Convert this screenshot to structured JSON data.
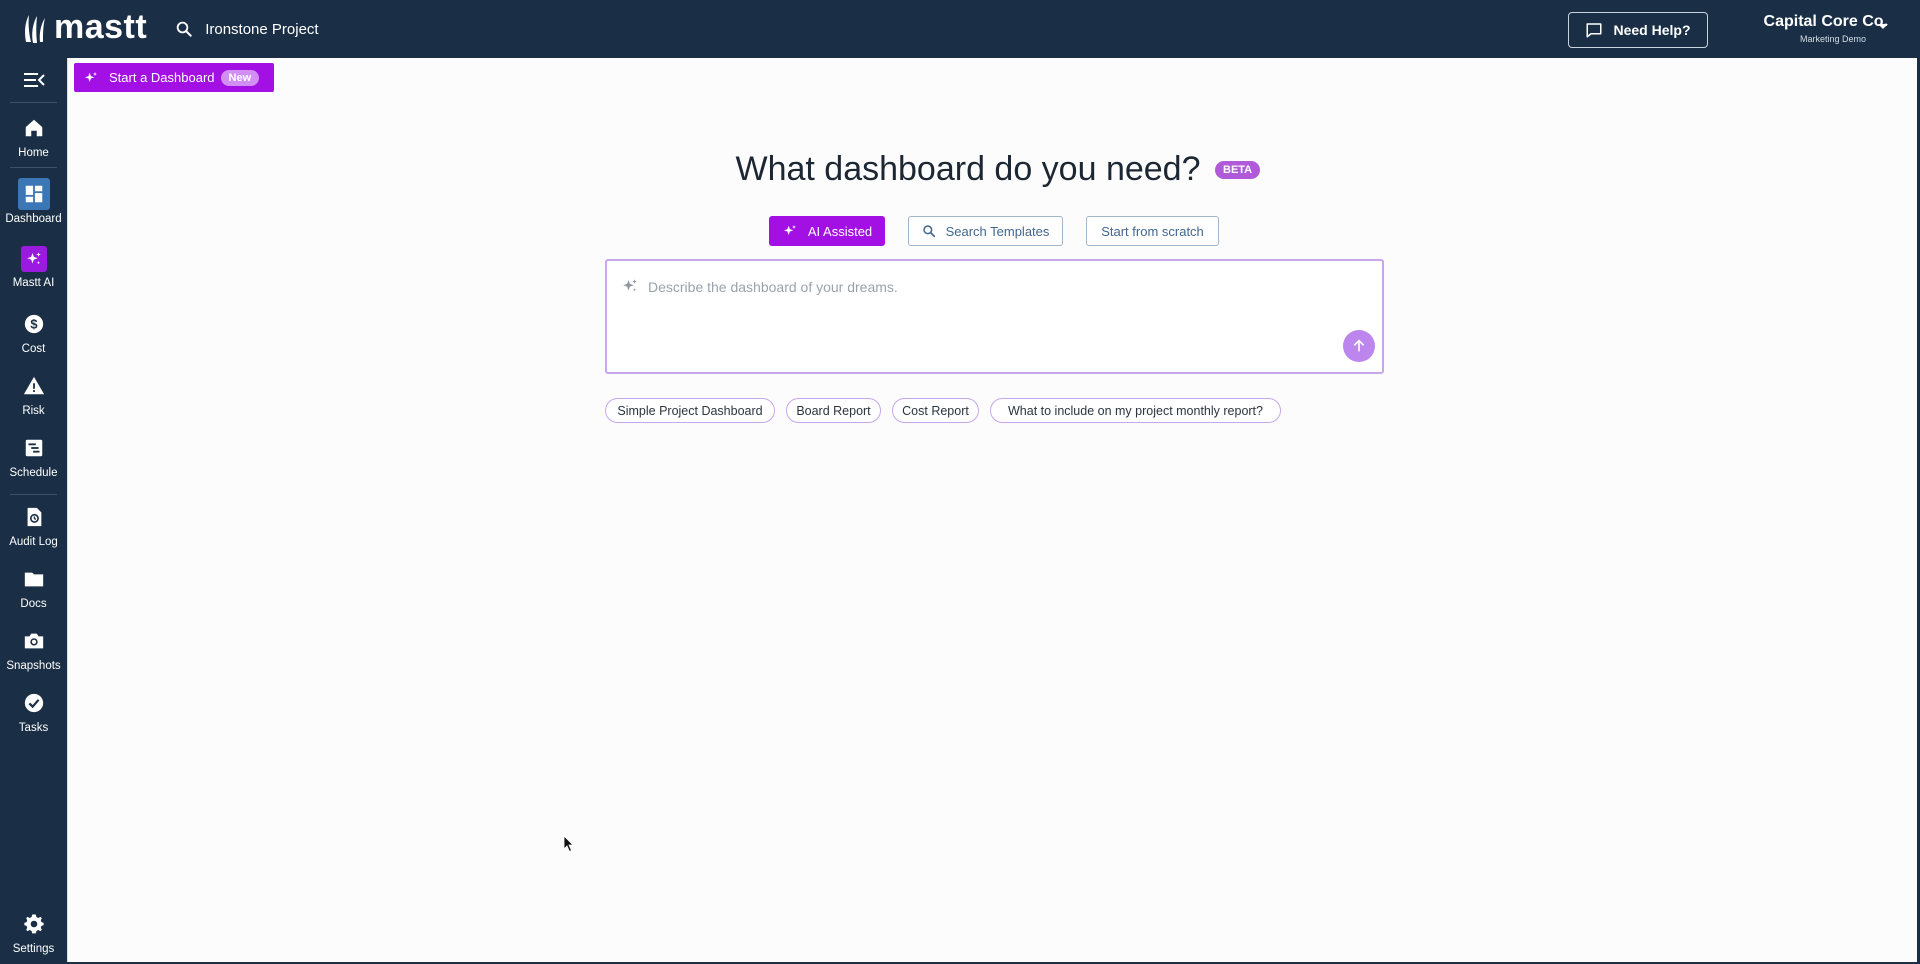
{
  "app": {
    "logo_text": "mastt",
    "project_name": "Ironstone Project",
    "help_label": "Need Help?",
    "company_name": "Capital Core Co.",
    "company_sub": "Marketing Demo"
  },
  "sidebar": {
    "items": [
      {
        "label": "Home",
        "icon": "home-icon"
      },
      {
        "label": "Dashboard",
        "icon": "dashboard-icon",
        "active": true
      },
      {
        "label": "Mastt AI",
        "icon": "sparkle-icon"
      },
      {
        "label": "Cost",
        "icon": "dollar-icon"
      },
      {
        "label": "Risk",
        "icon": "warning-icon"
      },
      {
        "label": "Schedule",
        "icon": "schedule-icon"
      },
      {
        "label": "Audit Log",
        "icon": "audit-log-icon"
      },
      {
        "label": "Docs",
        "icon": "folder-icon"
      },
      {
        "label": "Snapshots",
        "icon": "camera-icon"
      },
      {
        "label": "Tasks",
        "icon": "check-circle-icon"
      }
    ],
    "settings_label": "Settings"
  },
  "main": {
    "start_button": "Start a Dashboard",
    "new_badge": "New",
    "heading": "What dashboard do you need?",
    "beta_badge": "BETA",
    "modes": {
      "ai": "AI Assisted",
      "search": "Search Templates",
      "scratch": "Start from scratch"
    },
    "prompt_placeholder": "Describe the dashboard of your dreams.",
    "prompt_value": "",
    "suggestions": [
      "Simple Project Dashboard",
      "Board Report",
      "Cost Report",
      "What to include on my project monthly report?"
    ]
  },
  "colors": {
    "navy": "#1a2f45",
    "purple": "#a210e4",
    "light_purple": "#c8a6ec",
    "active_blue": "#3b77b6"
  }
}
